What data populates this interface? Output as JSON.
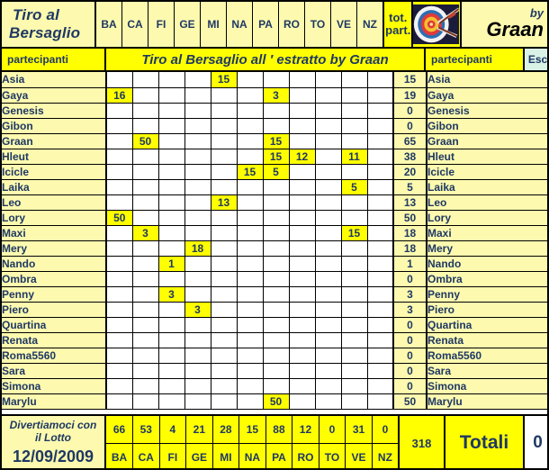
{
  "header": {
    "title_line1": "Tiro  al",
    "title_line2": "Bersaglio",
    "by_label": "by",
    "author": "Graan",
    "logo_icon": "archery-target-icon",
    "total_participants_label_line1": "tot.",
    "total_participants_label_line2": "part."
  },
  "subtitle": {
    "participants_left": "partecipanti",
    "banner": "Tiro al Bersaglio all ′ estratto  by Graan",
    "participants_right": "partecipanti",
    "esc_label": "Esc"
  },
  "columns": [
    "BA",
    "CA",
    "FI",
    "GE",
    "MI",
    "NA",
    "PA",
    "RO",
    "TO",
    "VE",
    "NZ"
  ],
  "rows": [
    {
      "name": "Asia",
      "values": [
        "",
        "",
        "",
        "",
        "15",
        "",
        "",
        "",
        "",
        "",
        ""
      ],
      "total": "15"
    },
    {
      "name": "Gaya",
      "values": [
        "16",
        "",
        "",
        "",
        "",
        "",
        "3",
        "",
        "",
        "",
        ""
      ],
      "total": "19"
    },
    {
      "name": "Genesis",
      "values": [
        "",
        "",
        "",
        "",
        "",
        "",
        "",
        "",
        "",
        "",
        ""
      ],
      "total": "0"
    },
    {
      "name": "Gibon",
      "values": [
        "",
        "",
        "",
        "",
        "",
        "",
        "",
        "",
        "",
        "",
        ""
      ],
      "total": "0"
    },
    {
      "name": "Graan",
      "values": [
        "",
        "50",
        "",
        "",
        "",
        "",
        "15",
        "",
        "",
        "",
        ""
      ],
      "total": "65"
    },
    {
      "name": "Hleut",
      "values": [
        "",
        "",
        "",
        "",
        "",
        "",
        "15",
        "12",
        "",
        "11",
        ""
      ],
      "total": "38"
    },
    {
      "name": "Icicle",
      "values": [
        "",
        "",
        "",
        "",
        "",
        "15",
        "5",
        "",
        "",
        "",
        ""
      ],
      "total": "20"
    },
    {
      "name": "Laika",
      "values": [
        "",
        "",
        "",
        "",
        "",
        "",
        "",
        "",
        "",
        "5",
        ""
      ],
      "total": "5"
    },
    {
      "name": "Leo",
      "values": [
        "",
        "",
        "",
        "",
        "13",
        "",
        "",
        "",
        "",
        "",
        ""
      ],
      "total": "13"
    },
    {
      "name": "Lory",
      "values": [
        "50",
        "",
        "",
        "",
        "",
        "",
        "",
        "",
        "",
        "",
        ""
      ],
      "total": "50"
    },
    {
      "name": "Maxi",
      "values": [
        "",
        "3",
        "",
        "",
        "",
        "",
        "",
        "",
        "",
        "15",
        ""
      ],
      "total": "18"
    },
    {
      "name": "Mery",
      "values": [
        "",
        "",
        "",
        "18",
        "",
        "",
        "",
        "",
        "",
        "",
        ""
      ],
      "total": "18"
    },
    {
      "name": "Nando",
      "values": [
        "",
        "",
        "1",
        "",
        "",
        "",
        "",
        "",
        "",
        "",
        ""
      ],
      "total": "1"
    },
    {
      "name": "Ombra",
      "values": [
        "",
        "",
        "",
        "",
        "",
        "",
        "",
        "",
        "",
        "",
        ""
      ],
      "total": "0"
    },
    {
      "name": "Penny",
      "values": [
        "",
        "",
        "3",
        "",
        "",
        "",
        "",
        "",
        "",
        "",
        ""
      ],
      "total": "3"
    },
    {
      "name": "Piero",
      "values": [
        "",
        "",
        "",
        "3",
        "",
        "",
        "",
        "",
        "",
        "",
        ""
      ],
      "total": "3"
    },
    {
      "name": "Quartina",
      "values": [
        "",
        "",
        "",
        "",
        "",
        "",
        "",
        "",
        "",
        "",
        ""
      ],
      "total": "0"
    },
    {
      "name": "Renata",
      "values": [
        "",
        "",
        "",
        "",
        "",
        "",
        "",
        "",
        "",
        "",
        ""
      ],
      "total": "0"
    },
    {
      "name": "Roma5560",
      "values": [
        "",
        "",
        "",
        "",
        "",
        "",
        "",
        "",
        "",
        "",
        ""
      ],
      "total": "0"
    },
    {
      "name": "Sara",
      "values": [
        "",
        "",
        "",
        "",
        "",
        "",
        "",
        "",
        "",
        "",
        ""
      ],
      "total": "0"
    },
    {
      "name": "Simona",
      "values": [
        "",
        "",
        "",
        "",
        "",
        "",
        "",
        "",
        "",
        "",
        ""
      ],
      "total": "0"
    },
    {
      "name": "Marylu",
      "values": [
        "",
        "",
        "",
        "",
        "",
        "",
        "50",
        "",
        "",
        "",
        ""
      ],
      "total": "50"
    }
  ],
  "footer": {
    "slogan_line1": "Divertiamoci con",
    "slogan_line2": "il Lotto",
    "date": "12/09/2009",
    "column_totals": [
      "66",
      "53",
      "4",
      "21",
      "28",
      "15",
      "88",
      "12",
      "0",
      "31",
      "0"
    ],
    "column_labels": [
      "BA",
      "CA",
      "FI",
      "GE",
      "MI",
      "NA",
      "PA",
      "RO",
      "TO",
      "VE",
      "NZ"
    ],
    "grand_total": "318",
    "totali_label": "Totali",
    "totali_value": "0"
  },
  "colors": {
    "accent_yellow": "#ffff00",
    "pale_yellow": "#fdfaaf",
    "text_blue": "#1f3864",
    "esc_green": "#d9f2e6",
    "border": "#000000"
  }
}
